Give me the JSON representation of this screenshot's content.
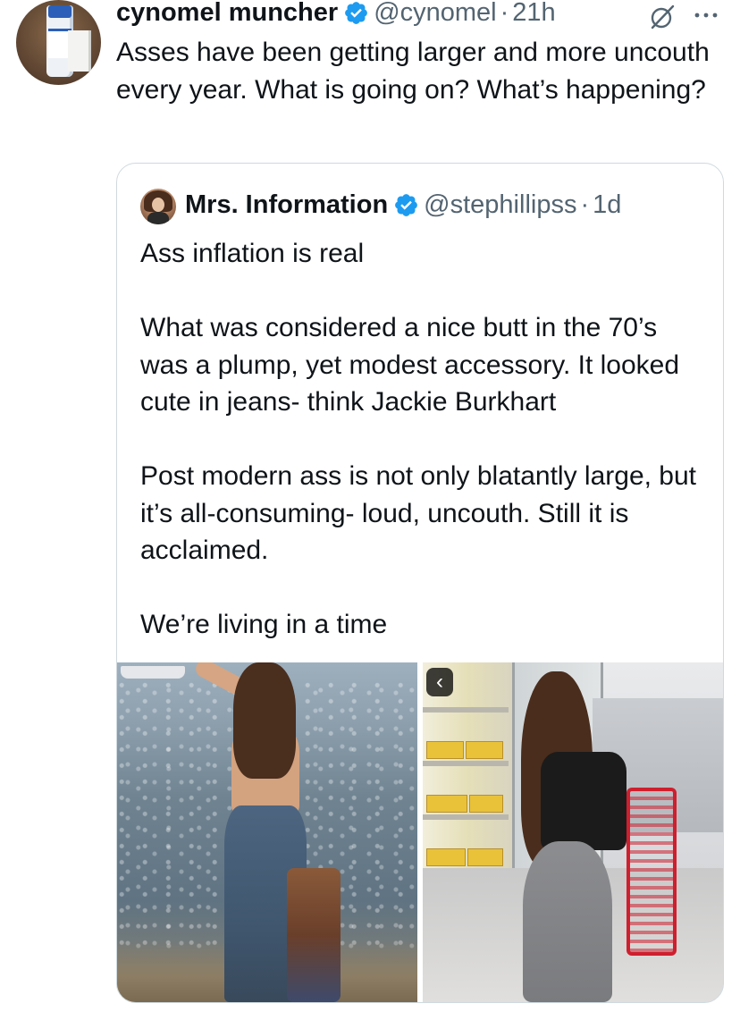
{
  "tweet": {
    "author_name": "cynomel muncher",
    "author_handle": "@cynomel",
    "separator": "·",
    "time": "21h",
    "avatar_label": "Cynomel",
    "text": "Asses have been getting larger and more uncouth every year. What is going on? What’s happening?"
  },
  "quoted": {
    "author_name": "Mrs. Information",
    "author_handle": "@stephillipss",
    "separator": "·",
    "time": "1d",
    "text": "Ass inflation is real\n\nWhat was considered a nice butt in the 70’s was a plump, yet modest accessory. It looked cute in jeans- think Jackie Burkhart\n\nPost modern ass is not only blatantly large, but it’s all-consuming- loud, uncouth. Still it is acclaimed.\n\nWe’re living in a time",
    "media_nav": "‹"
  },
  "icons": {
    "verified": "verified-badge-icon",
    "grok": "grok-icon",
    "more": "more-options-icon"
  },
  "colors": {
    "text_primary": "#0f1419",
    "text_secondary": "#536471",
    "verified_blue": "#1d9bf0",
    "border": "#cfd9de"
  }
}
